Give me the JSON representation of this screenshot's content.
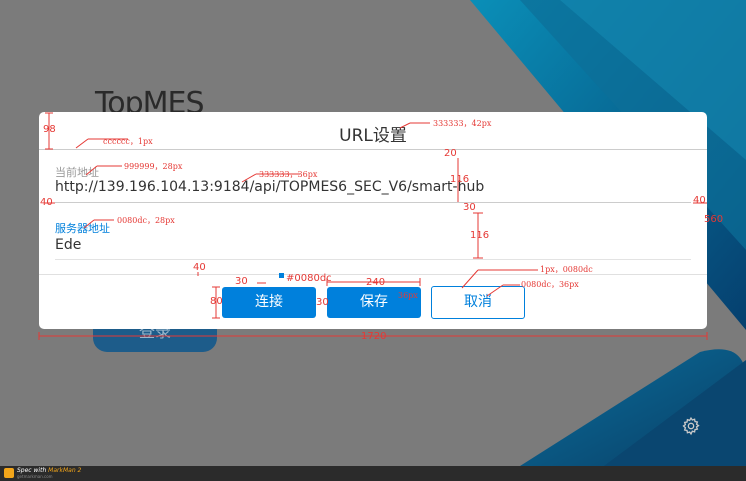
{
  "app": {
    "title": "TopMES",
    "login_label": "登录"
  },
  "dialog": {
    "title": "URL设置",
    "current_label": "当前地址",
    "current_value": "http://139.196.104.13:9184/api/TOPMES6_SEC_V6/smart-hub",
    "server_label": "服务器地址",
    "server_value": "Ede",
    "buttons": {
      "connect": "连接",
      "save": "保存",
      "cancel": "取消"
    }
  },
  "colors": {
    "primary": "#0080dc",
    "title_text": "#333333",
    "label_gray": "#999999",
    "divider": "#cccccc",
    "annotation": "#e53935"
  },
  "annotations": {
    "title_spec": "333333，42px",
    "divider_spec": "cccccc，1px",
    "label_spec": "999999，28px",
    "value_spec": "333333，36px",
    "server_label_spec": "0080dc，28px",
    "outline_spec": "1px，0080dc",
    "cancel_spec": "0080dc，36px",
    "primary_color": "#0080dc",
    "btn_font": "36px",
    "m98": "98",
    "m20": "20",
    "m116a": "116",
    "m116b": "116",
    "m30a": "30",
    "m40a": "40",
    "m40b": "40",
    "m40c": "40",
    "m30b": "30",
    "m30c": "30",
    "m80": "80",
    "m240": "240",
    "m1720": "1720",
    "m560": "560"
  },
  "footer": {
    "prefix": "Spec with",
    "brand": "MarkMan 2",
    "sub": "getmarkman.com"
  },
  "icons": {
    "settings": "gear-icon",
    "logo": "markman-logo-icon"
  }
}
